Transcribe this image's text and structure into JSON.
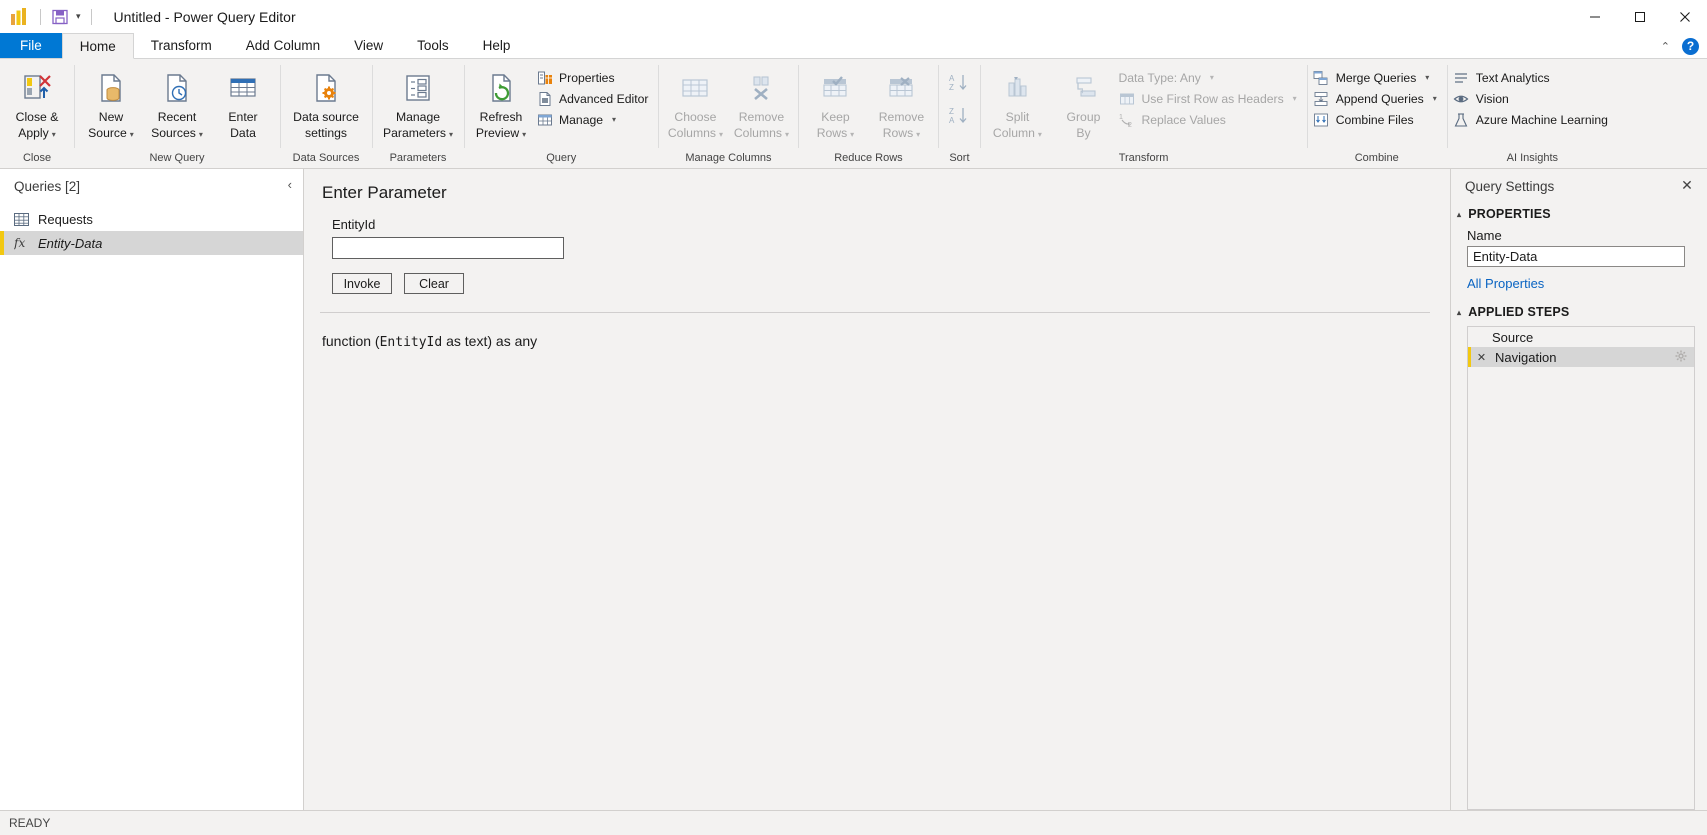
{
  "titlebar": {
    "app_icon": "power-bi-logo-icon",
    "save_icon": "save-icon",
    "quick_access_caret": "▾",
    "title": "Untitled - Power Query Editor",
    "minimize": "—",
    "maximize": "☐",
    "close": "✕"
  },
  "tabs": [
    {
      "label": "File",
      "kind": "file"
    },
    {
      "label": "Home",
      "kind": "active"
    },
    {
      "label": "Transform",
      "kind": "normal"
    },
    {
      "label": "Add Column",
      "kind": "normal"
    },
    {
      "label": "View",
      "kind": "normal"
    },
    {
      "label": "Tools",
      "kind": "normal"
    },
    {
      "label": "Help",
      "kind": "normal"
    }
  ],
  "tabstrip_right": {
    "collapse_ribbon": "⌃",
    "help": "?"
  },
  "ribbon": {
    "groups": [
      {
        "label": "Close"
      },
      {
        "label": "New Query"
      },
      {
        "label": "Data Sources"
      },
      {
        "label": "Parameters"
      },
      {
        "label": "Query"
      },
      {
        "label": "Manage Columns"
      },
      {
        "label": "Reduce Rows"
      },
      {
        "label": "Sort"
      },
      {
        "label": "Transform"
      },
      {
        "label": "Combine"
      },
      {
        "label": "AI Insights"
      }
    ],
    "close_apply": {
      "line1": "Close &",
      "line2": "Apply",
      "caret": "▾"
    },
    "new_source": {
      "line1": "New",
      "line2": "Source",
      "caret": "▾"
    },
    "recent_sources": {
      "line1": "Recent",
      "line2": "Sources",
      "caret": "▾"
    },
    "enter_data": {
      "line1": "Enter",
      "line2": "Data"
    },
    "data_source_settings": {
      "line1": "Data source",
      "line2": "settings"
    },
    "manage_parameters": {
      "line1": "Manage",
      "line2": "Parameters",
      "caret": "▾"
    },
    "refresh_preview": {
      "line1": "Refresh",
      "line2": "Preview",
      "caret": "▾"
    },
    "properties": "Properties",
    "advanced_editor": "Advanced Editor",
    "manage": {
      "label": "Manage",
      "caret": "▾"
    },
    "choose_columns": {
      "line1": "Choose",
      "line2": "Columns",
      "caret": "▾"
    },
    "remove_columns": {
      "line1": "Remove",
      "line2": "Columns",
      "caret": "▾"
    },
    "keep_rows": {
      "line1": "Keep",
      "line2": "Rows",
      "caret": "▾"
    },
    "remove_rows": {
      "line1": "Remove",
      "line2": "Rows",
      "caret": "▾"
    },
    "split_column": {
      "line1": "Split",
      "line2": "Column",
      "caret": "▾"
    },
    "group_by": {
      "line1": "Group",
      "line2": "By"
    },
    "data_type": {
      "label": "Data Type: Any",
      "caret": "▾"
    },
    "use_first_row": {
      "label": "Use First Row as Headers",
      "caret": "▾"
    },
    "replace_values": "Replace Values",
    "merge_queries": {
      "label": "Merge Queries",
      "caret": "▾"
    },
    "append_queries": {
      "label": "Append Queries",
      "caret": "▾"
    },
    "combine_files": "Combine Files",
    "text_analytics": "Text Analytics",
    "vision": "Vision",
    "azure_ml": "Azure Machine Learning"
  },
  "queries_pane": {
    "title": "Queries [2]",
    "collapse_icon": "‹",
    "items": [
      {
        "label": "Requests",
        "icon": "table-icon",
        "selected": false
      },
      {
        "label": "Entity-Data",
        "icon": "function-fx-icon",
        "selected": true
      }
    ]
  },
  "main": {
    "heading": "Enter Parameter",
    "param_label": "EntityId",
    "param_value": "",
    "param_placeholder": "",
    "invoke_label": "Invoke",
    "clear_label": "Clear",
    "signature_prefix": "function (",
    "signature_param": "EntityId",
    "signature_suffix": " as text) as any"
  },
  "settings_pane": {
    "title": "Query Settings",
    "close_icon": "✕",
    "properties_section": "PROPERTIES",
    "name_label": "Name",
    "name_value": "Entity-Data",
    "all_properties_link": "All Properties",
    "applied_steps_section": "APPLIED STEPS",
    "steps": [
      {
        "label": "Source",
        "selected": false,
        "deletable": false,
        "has_gear": false
      },
      {
        "label": "Navigation",
        "selected": true,
        "deletable": true,
        "has_gear": true
      }
    ],
    "delete_icon": "✕",
    "gear_icon": "⚙",
    "triangle": "▴"
  },
  "statusbar": {
    "text": "READY"
  },
  "colors": {
    "accent_blue": "#0078d4",
    "ribbon_bg": "#f3f2f1",
    "selection_yellow": "#f2c811",
    "link_blue": "#0a64c2"
  }
}
